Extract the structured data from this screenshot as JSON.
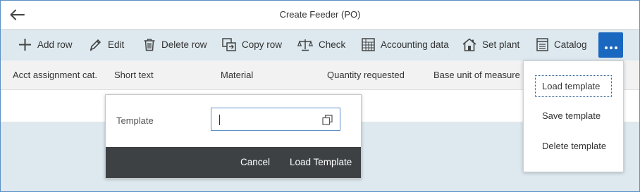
{
  "header": {
    "title": "Create Feeder (PO)",
    "back_icon": "back-arrow-icon"
  },
  "toolbar": {
    "add_row": "Add row",
    "edit": "Edit",
    "delete_row": "Delete row",
    "copy_row": "Copy row",
    "check": "Check",
    "accounting_data": "Accounting data",
    "set_plant": "Set plant",
    "catalog": "Catalog",
    "more_color": "#1a67c0"
  },
  "table": {
    "columns": [
      "Acct assignment cat.",
      "Short text",
      "Material",
      "Quantity requested",
      "Base unit of measure"
    ]
  },
  "template_popup": {
    "label": "Template",
    "input_value": "",
    "cancel": "Cancel",
    "load_template": "Load Template"
  },
  "more_menu": {
    "items": [
      "Load template",
      "Save template",
      "Delete template"
    ]
  }
}
